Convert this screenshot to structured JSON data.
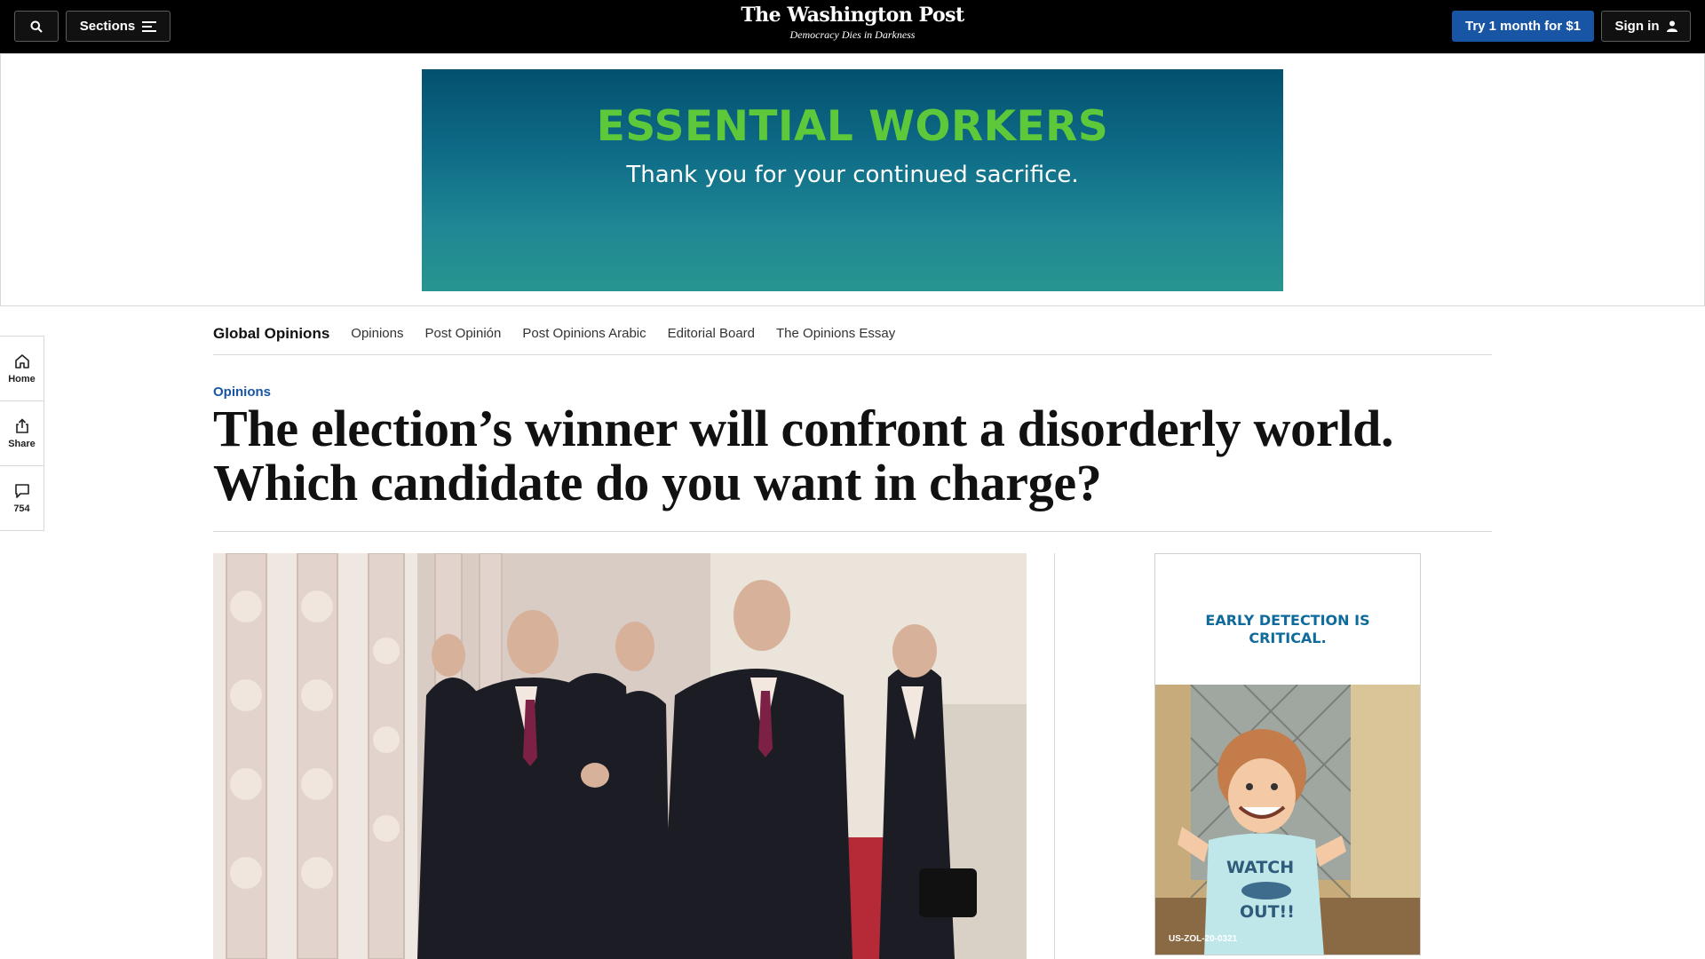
{
  "header": {
    "search_icon": "search-icon",
    "sections_label": "Sections",
    "logo_name": "The Washington Post",
    "logo_tagline": "Democracy Dies in Darkness",
    "trial_label": "Try 1 month for $1",
    "signin_label": "Sign in"
  },
  "banner_ad": {
    "headline": "ESSENTIAL WORKERS",
    "subline": "Thank you for your continued sacrifice.",
    "colors": {
      "headline": "#5dc93a",
      "top": "#04506f",
      "bottom": "#27958f"
    }
  },
  "left_rail": {
    "items": [
      {
        "label": "Home",
        "icon": "home-icon"
      },
      {
        "label": "Share",
        "icon": "share-icon"
      },
      {
        "label": "754",
        "icon": "comment-icon"
      }
    ]
  },
  "section_nav": {
    "brand": "Global Opinions",
    "links": [
      "Opinions",
      "Post Opinión",
      "Post Opinions Arabic",
      "Editorial Board",
      "The Opinions Essay"
    ]
  },
  "article": {
    "kicker": "Opinions",
    "headline_line1": "The election’s winner will confront a disorderly world.",
    "headline_line2": "Which candidate do you want in charge?"
  },
  "side_ad": {
    "headline": "EARLY DETECTION IS CRITICAL.",
    "shirt_text_1": "WATCH",
    "shirt_text_2": "OUT!!",
    "code": "US-ZOL-20-0321"
  },
  "colors": {
    "accent": "#1955a5",
    "topbar": "#000000"
  }
}
